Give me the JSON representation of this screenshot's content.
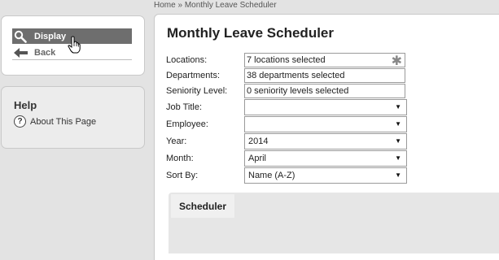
{
  "breadcrumb": {
    "home": "Home",
    "separator": "»",
    "current": "Monthly Leave Scheduler"
  },
  "actions": {
    "display_label": "Display",
    "back_label": "Back"
  },
  "help": {
    "title": "Help",
    "about_label": "About This Page",
    "about_icon": "?"
  },
  "page": {
    "title": "Monthly Leave Scheduler"
  },
  "form": {
    "locations": {
      "label": "Locations:",
      "value": "7 locations selected",
      "required_mark": "✱"
    },
    "departments": {
      "label": "Departments:",
      "value": "38 departments selected"
    },
    "seniority": {
      "label": "Seniority Level:",
      "value": "0 seniority levels selected"
    },
    "job_title": {
      "label": "Job Title:",
      "value": ""
    },
    "employee": {
      "label": "Employee:",
      "value": ""
    },
    "year": {
      "label": "Year:",
      "value": "2014"
    },
    "month": {
      "label": "Month:",
      "value": "April"
    },
    "sort_by": {
      "label": "Sort By:",
      "value": "Name (A-Z)"
    }
  },
  "tabs": [
    {
      "label": "Scheduler"
    }
  ],
  "icons": {
    "caret": "▼",
    "display": "magnifier-icon",
    "back": "left-arrow-icon",
    "cursor": "hand-pointer-icon"
  },
  "colors": {
    "display_button_bg": "#6e6e6e",
    "page_bg": "#e3e3e3"
  }
}
